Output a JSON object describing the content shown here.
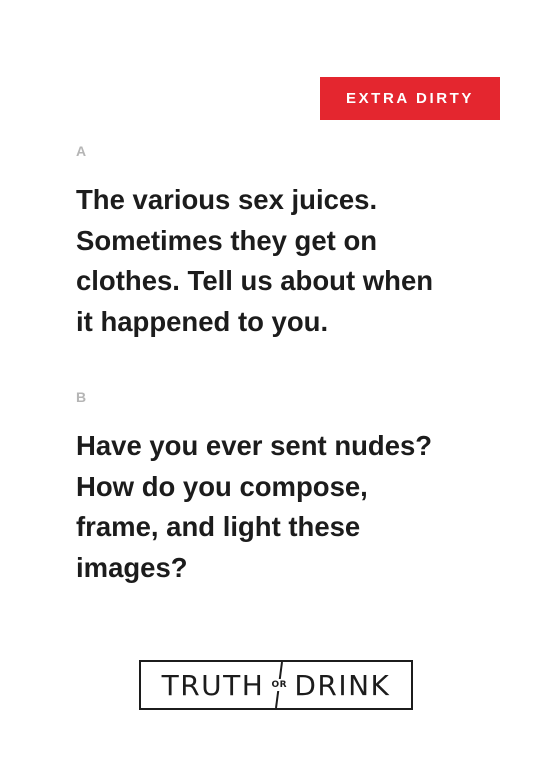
{
  "badge": {
    "label": "EXTRA DIRTY",
    "color": "#e4262f"
  },
  "options": [
    {
      "letter": "A",
      "lines": [
        "The various sex juices.",
        "Sometimes they get on",
        "clothes. Tell us about when",
        "it happened to you."
      ]
    },
    {
      "letter": "B",
      "lines": [
        "Have you ever sent nudes?",
        "How do you compose,",
        "frame, and light these",
        "images?"
      ]
    }
  ],
  "logo": {
    "left": "TRUTH",
    "middle": "OR",
    "right": "DRINK"
  }
}
